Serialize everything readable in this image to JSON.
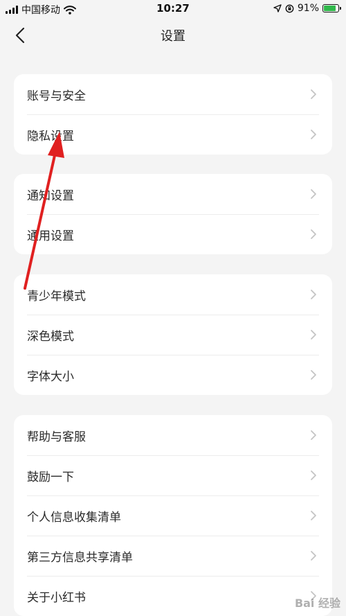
{
  "status_bar": {
    "carrier": "中国移动",
    "time": "10:27",
    "battery_percent": "91%",
    "battery_level": 0.91,
    "icons": [
      "signal-icon",
      "wifi-icon",
      "location-icon",
      "orientation-lock-icon",
      "battery-icon"
    ]
  },
  "nav": {
    "title": "设置",
    "back_icon": "chevron-left-icon"
  },
  "groups": [
    {
      "items": [
        {
          "label": "账号与安全"
        },
        {
          "label": "隐私设置"
        }
      ]
    },
    {
      "items": [
        {
          "label": "通知设置"
        },
        {
          "label": "通用设置"
        }
      ]
    },
    {
      "items": [
        {
          "label": "青少年模式"
        },
        {
          "label": "深色模式"
        },
        {
          "label": "字体大小"
        }
      ]
    },
    {
      "items": [
        {
          "label": "帮助与客服"
        },
        {
          "label": "鼓励一下"
        },
        {
          "label": "个人信息收集清单"
        },
        {
          "label": "第三方信息共享清单"
        },
        {
          "label": "关于小红书"
        }
      ]
    }
  ],
  "annotation": {
    "arrow_color": "#e02020",
    "points_to": "隐私设置"
  },
  "watermark": "Bai 经验",
  "colors": {
    "background": "#f4f4f4",
    "card": "#ffffff",
    "divider": "#ececec",
    "chevron": "#c4c4c4",
    "battery_fill": "#2fb84a"
  }
}
